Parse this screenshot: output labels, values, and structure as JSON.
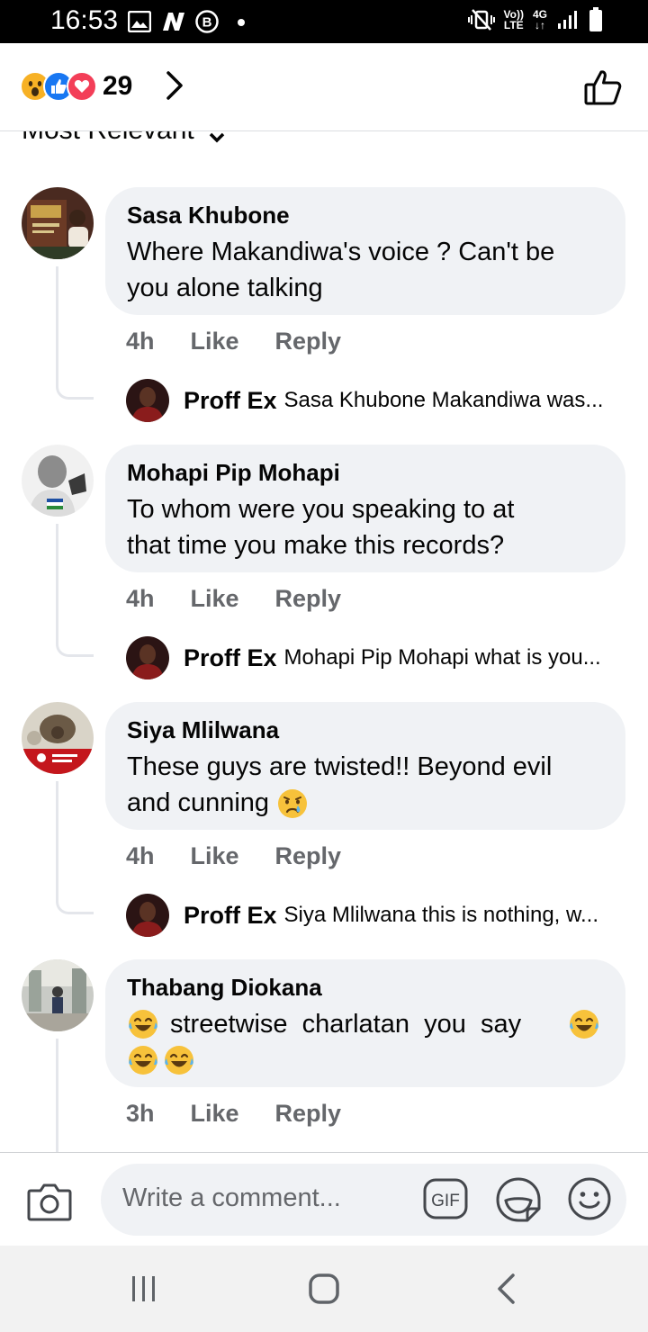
{
  "status_bar": {
    "time": "16:53",
    "volte": "Vo))",
    "lte": "LTE",
    "network": "4G"
  },
  "header": {
    "reaction_count": "29",
    "reactions": [
      "wow",
      "like",
      "love"
    ]
  },
  "sort": {
    "label": "Most Relevant"
  },
  "comments": [
    {
      "author": "Sasa Khubone",
      "text_lines": [
        "Where Makandiwa's voice ? Can't be",
        "you alone talking"
      ],
      "time": "4h",
      "like_label": "Like",
      "reply_label": "Reply",
      "reply": {
        "author": "Proff Ex",
        "text": "Sasa Khubone Makandiwa was..."
      }
    },
    {
      "author": "Mohapi Pip Mohapi",
      "text_lines": [
        "To whom were you speaking to at",
        "that time you make this records?"
      ],
      "time": "4h",
      "like_label": "Like",
      "reply_label": "Reply",
      "reply": {
        "author": "Proff Ex",
        "text": "Mohapi Pip Mohapi what is you..."
      }
    },
    {
      "author": "Siya Mlilwana",
      "text_lines": [
        "These guys are twisted!! Beyond evil",
        "and cunning"
      ],
      "time": "4h",
      "like_label": "Like",
      "reply_label": "Reply",
      "reply": {
        "author": "Proff Ex",
        "text": "Siya Mlilwana this is nothing, w..."
      }
    },
    {
      "author": "Thabang Diokana",
      "text_main": "streetwise  charlatan  you  say",
      "time": "3h",
      "like_label": "Like",
      "reply_label": "Reply"
    }
  ],
  "composer": {
    "placeholder": "Write a comment...",
    "gif_label": "GIF"
  },
  "colors": {
    "bubble": "#f0f2f5",
    "meta": "#65676b",
    "like_blue": "#1877f2",
    "love_red": "#f33e58"
  }
}
